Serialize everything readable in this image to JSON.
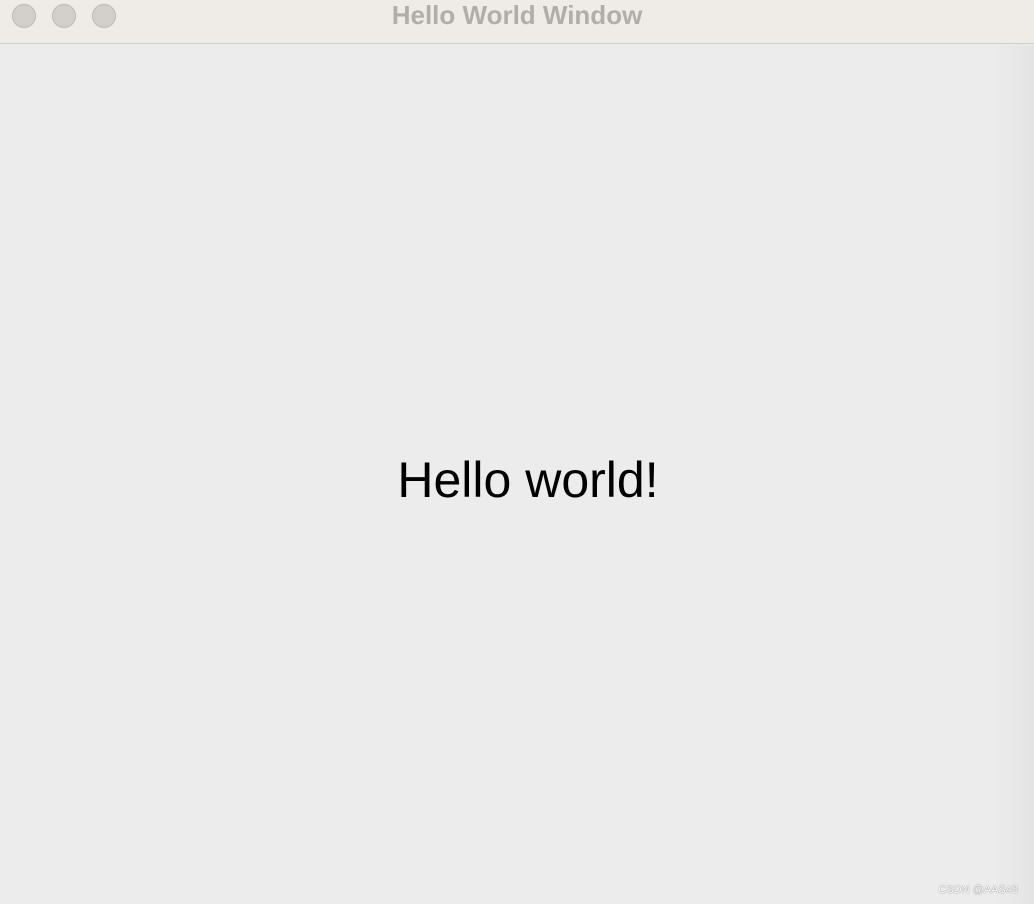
{
  "window": {
    "title": "Hello World Window",
    "controls": {
      "close_icon": "window-close-icon",
      "minimize_icon": "window-minimize-icon",
      "zoom_icon": "window-zoom-icon",
      "color": "#d3d0cc"
    }
  },
  "content": {
    "label_text": "Hello world!"
  },
  "watermark": {
    "text": "CSDN @AAS48"
  },
  "colors": {
    "titlebar_bg": "#efece7",
    "content_bg": "#ececec",
    "title_text": "#b1aea9",
    "label_text": "#000000"
  }
}
